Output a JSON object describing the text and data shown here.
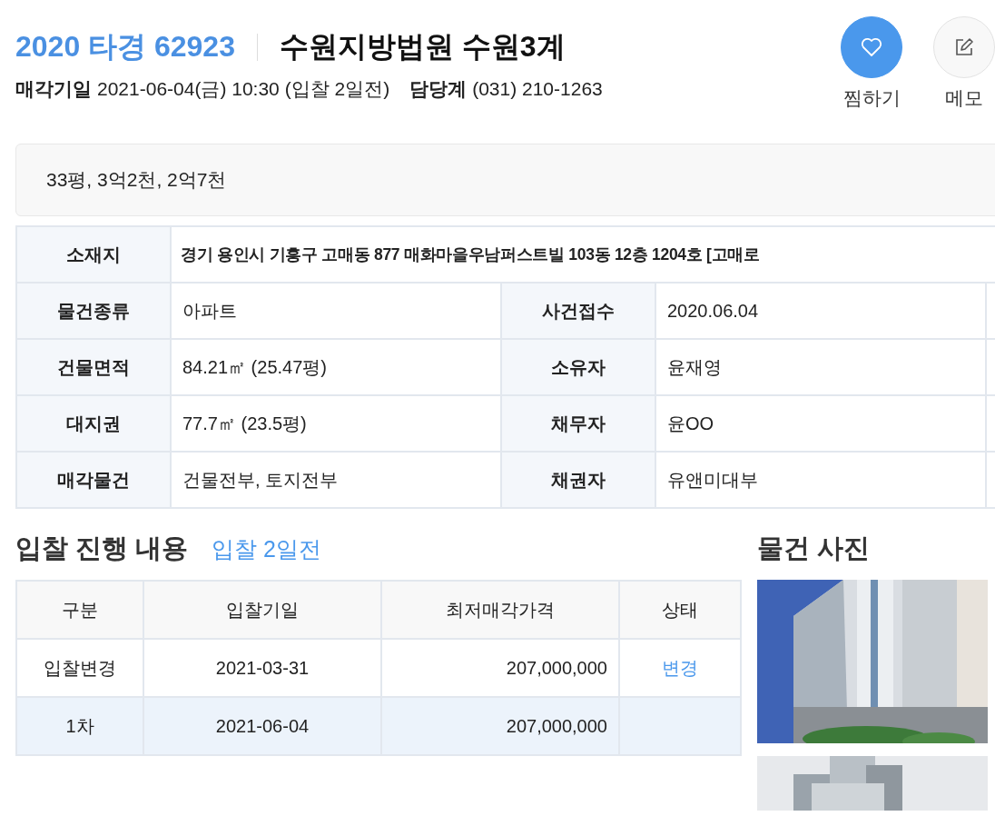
{
  "header": {
    "case_number": "2020 타경 62923",
    "court": "수원지방법원 수원3계",
    "sale_date_label": "매각기일",
    "sale_date": "2021-06-04(금) 10:30 (입찰 2일전)",
    "dept_label": "담당계",
    "dept_phone": "(031) 210-1263"
  },
  "actions": [
    {
      "kind": "favorite",
      "label": "찜하기",
      "selected": true
    },
    {
      "kind": "memo",
      "label": "메모",
      "selected": false
    }
  ],
  "summary": "33평, 3억2천, 2억7천",
  "info": {
    "address_label": "소재지",
    "address": "경기 용인시 기흥구 고매동 877 매화마을우남퍼스트빌 103동 12층 1204호 [고매로",
    "rows": [
      {
        "label_1": "물건종류",
        "value_1": "아파트",
        "label_2": "사건접수",
        "value_2": "2020.06.04"
      },
      {
        "label_1": "건물면적",
        "value_1": "84.21㎡ (25.47평)",
        "label_2": "소유자",
        "value_2": "윤재영"
      },
      {
        "label_1": "대지권",
        "value_1": "77.7㎡ (23.5평)",
        "label_2": "채무자",
        "value_2": "윤OO"
      },
      {
        "label_1": "매각물건",
        "value_1": "건물전부, 토지전부",
        "label_2": "채권자",
        "value_2": "유앤미대부"
      }
    ]
  },
  "bidding": {
    "title": "입찰 진행 내용",
    "badge": "입찰 2일전",
    "columns": [
      "구분",
      "입찰기일",
      "최저매각가격",
      "상태"
    ],
    "rows": [
      {
        "round": "입찰변경",
        "date": "2021-03-31",
        "price": "207,000,000",
        "status": "변경",
        "current": false
      },
      {
        "round": "1차",
        "date": "2021-06-04",
        "price": "207,000,000",
        "current": true
      }
    ]
  },
  "photos": {
    "title": "물건 사진"
  }
}
